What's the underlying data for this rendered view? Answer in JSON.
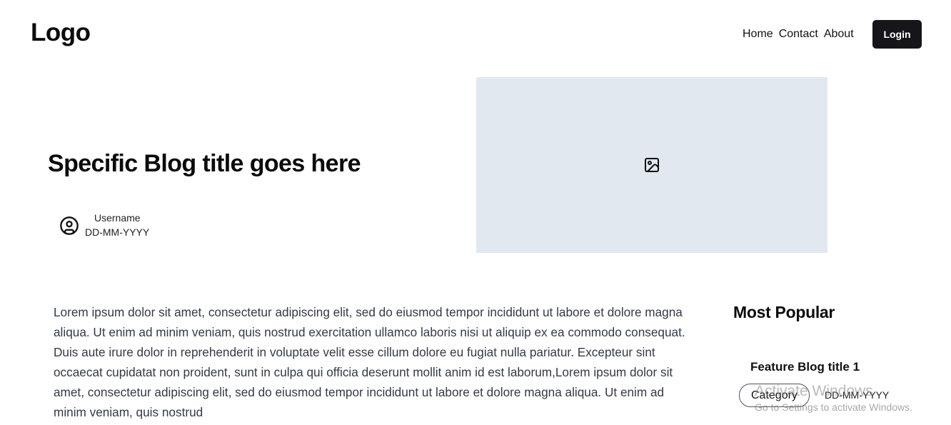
{
  "header": {
    "logo": "Logo",
    "nav": [
      "Home",
      "Contact",
      "About"
    ],
    "login_label": "Login"
  },
  "hero": {
    "title": "Specific Blog title goes here",
    "author": {
      "icon": "user-circle-icon",
      "username": "Username",
      "date": "DD-MM-YYYY"
    },
    "image_icon": "image-icon",
    "image_bg": "#e2e8f0"
  },
  "article": {
    "body": "Lorem ipsum dolor sit amet, consectetur adipiscing elit, sed do eiusmod tempor incididunt ut labore et dolore magna aliqua. Ut enim ad minim veniam, quis nostrud exercitation ullamco laboris nisi ut aliquip ex ea commodo consequat. Duis aute irure dolor in reprehenderit in voluptate velit esse cillum dolore eu fugiat nulla pariatur. Excepteur sint occaecat cupidatat non proident, sunt in culpa qui officia deserunt mollit anim id est laborum,Lorem ipsum dolor sit amet, consectetur adipiscing elit, sed do eiusmod tempor incididunt ut labore et dolore magna aliqua. Ut enim ad minim veniam, quis nostrud"
  },
  "sidebar": {
    "title": "Most Popular",
    "items": [
      {
        "title": "Feature Blog title 1",
        "category": "Category",
        "date": "DD-MM-YYYY"
      }
    ]
  },
  "watermark": {
    "title": "Activate Windows",
    "subtitle": "Go to Settings to activate Windows."
  },
  "colors": {
    "button_bg": "#16161a",
    "body_text": "#333a47"
  }
}
